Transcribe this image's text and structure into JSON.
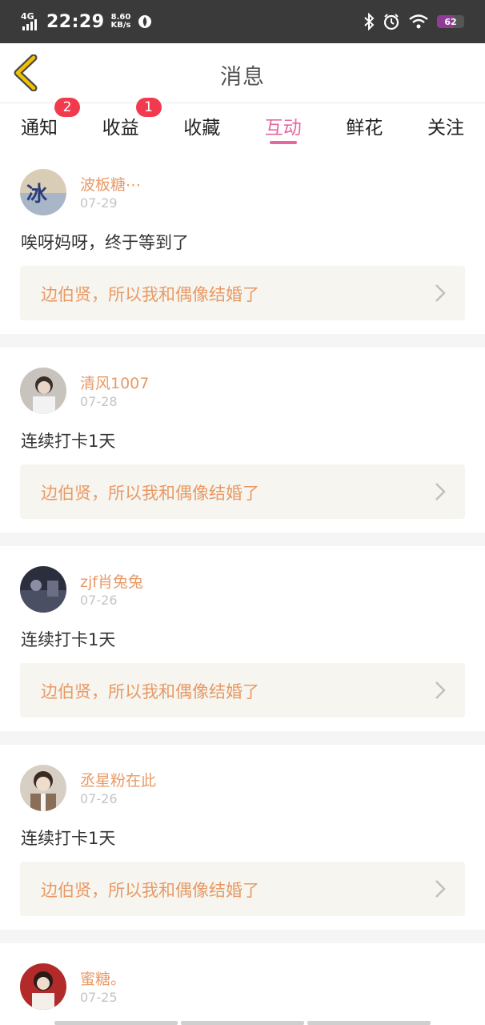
{
  "status_bar": {
    "network": "4G",
    "time": "22:29",
    "speed_value": "8.60",
    "speed_unit": "KB/s",
    "battery": "62"
  },
  "header": {
    "title": "消息"
  },
  "tabs": [
    {
      "label": "通知",
      "badge": "2"
    },
    {
      "label": "收益",
      "badge": "1"
    },
    {
      "label": "收藏"
    },
    {
      "label": "互动",
      "active": true
    },
    {
      "label": "鲜花"
    },
    {
      "label": "关注"
    }
  ],
  "messages": [
    {
      "user": "波板糖⋯",
      "date": "07-29",
      "comment": "唉呀妈呀，终于等到了",
      "ref": "边伯贤，所以我和偶像结婚了"
    },
    {
      "user": "清风1007",
      "date": "07-28",
      "comment": "连续打卡1天",
      "ref": "边伯贤，所以我和偶像结婚了"
    },
    {
      "user": "zjf肖兔兔",
      "date": "07-26",
      "comment": "连续打卡1天",
      "ref": "边伯贤，所以我和偶像结婚了"
    },
    {
      "user": "丞星粉在此",
      "date": "07-26",
      "comment": "连续打卡1天",
      "ref": "边伯贤，所以我和偶像结婚了"
    },
    {
      "user": "蜜糖。",
      "date": "07-25"
    }
  ],
  "colors": {
    "accent": "#e8669f",
    "username": "#e89a66",
    "badge": "#f23a4e",
    "ref_bg": "#f6f5ef",
    "back_arrow": "#f2c200"
  }
}
